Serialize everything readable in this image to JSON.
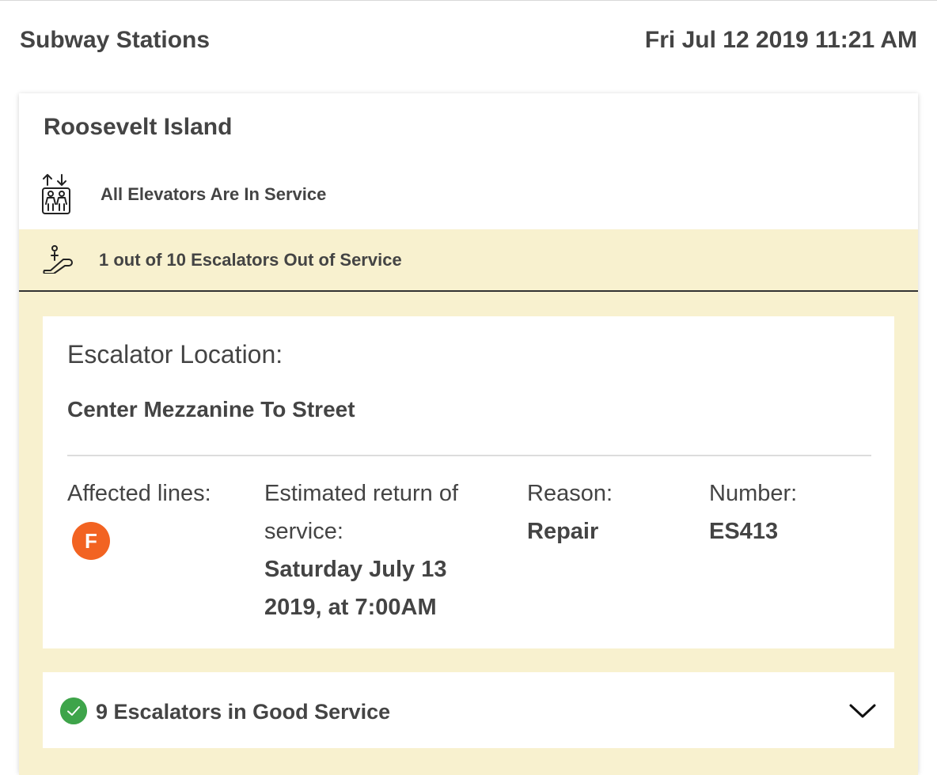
{
  "header": {
    "title": "Subway Stations",
    "datetime": "Fri Jul 12 2019 11:21 AM"
  },
  "station": {
    "name": "Roosevelt Island",
    "elevator_status": "All Elevators Are In Service",
    "escalator_status": "1 out of 10 Escalators Out of Service",
    "status_band_color": "#f8f1cf"
  },
  "outage": {
    "location_heading": "Escalator Location:",
    "location_value": "Center Mezzanine To Street",
    "affected_lines_label": "Affected lines:",
    "affected_lines": [
      {
        "line": "F",
        "color": "#f26322"
      }
    ],
    "return_label": "Estimated return of service:",
    "return_value": "Saturday July 13 2019, at 7:00AM",
    "reason_label": "Reason:",
    "reason_value": "Repair",
    "number_label": "Number:",
    "number_value": "ES413"
  },
  "good_service": {
    "label": "9 Escalators in Good Service",
    "check_color": "#3ea44a",
    "icon": "chevron-down-icon"
  }
}
